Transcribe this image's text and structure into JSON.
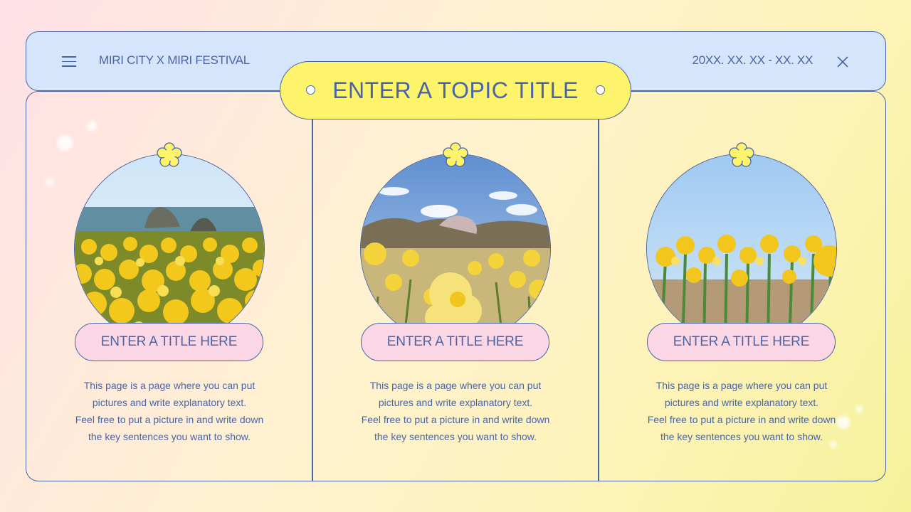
{
  "header": {
    "brand": "MIRI CITY X MIRI FESTIVAL",
    "date_range": "20XX. XX. XX - XX. XX"
  },
  "topic_title": "ENTER A TOPIC TITLE",
  "colors": {
    "accent_line": "#4a64a8",
    "header_bg": "#d4e5fc",
    "topic_pill": "#fdf46c",
    "title_button": "#fbd7e6"
  },
  "cards": [
    {
      "image": "daffodil field by the sea with rock islands",
      "title": "ENTER A TITLE HERE",
      "desc": [
        "This page is a page where you can put",
        "pictures and write explanatory text.",
        "Feel free to put a picture in and write down",
        "the key sentences you want to show."
      ]
    },
    {
      "image": "close-up daffodils with hills and blue sky",
      "title": "ENTER A TITLE HERE",
      "desc": [
        "This page is a page where you can put",
        "pictures and write explanatory text.",
        "Feel free to put a picture in and write down",
        "the key sentences you want to show."
      ]
    },
    {
      "image": "daffodils with green stems under blue sky",
      "title": "ENTER A TITLE HERE",
      "desc": [
        "This page is a page where you can put",
        "pictures and write explanatory text.",
        "Feel free to put a picture in and write down",
        "the key sentences you want to show."
      ]
    }
  ]
}
